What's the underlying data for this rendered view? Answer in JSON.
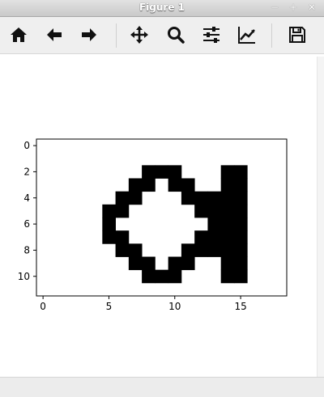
{
  "window": {
    "title": "Figure 1",
    "min_glyph": "−",
    "max_glyph": "+",
    "close_glyph": "✕"
  },
  "toolbar": {
    "buttons": [
      {
        "name": "home",
        "icon": "home-icon"
      },
      {
        "name": "back",
        "icon": "arrow-left-icon"
      },
      {
        "name": "forward",
        "icon": "arrow-right-icon"
      },
      {
        "name": "pan",
        "icon": "move-icon"
      },
      {
        "name": "zoom",
        "icon": "magnifier-icon"
      },
      {
        "name": "configure-subplots",
        "icon": "sliders-icon"
      },
      {
        "name": "edit-axis",
        "icon": "line-chart-icon"
      },
      {
        "name": "save",
        "icon": "floppy-disk-icon"
      }
    ]
  },
  "chart_data": {
    "type": "heatmap",
    "colormap": "binary",
    "grid": false,
    "xlim": [
      -0.5,
      18.5
    ],
    "ylim": [
      11.5,
      -0.5
    ],
    "xticks": [
      0,
      5,
      10,
      15
    ],
    "yticks": [
      0,
      2,
      4,
      6,
      8,
      10
    ],
    "rows": 12,
    "cols": 19,
    "cells": [
      "0000000000000000000",
      "0000000000000000000",
      "0000000011100011000",
      "0000000110110011000",
      "0000001100011111000",
      "0000011000001111000",
      "0000010000000111000",
      "0000011000001111000",
      "0000001100011111000",
      "0000000110110011000",
      "0000000011100011000",
      "0000000000000000000"
    ]
  }
}
